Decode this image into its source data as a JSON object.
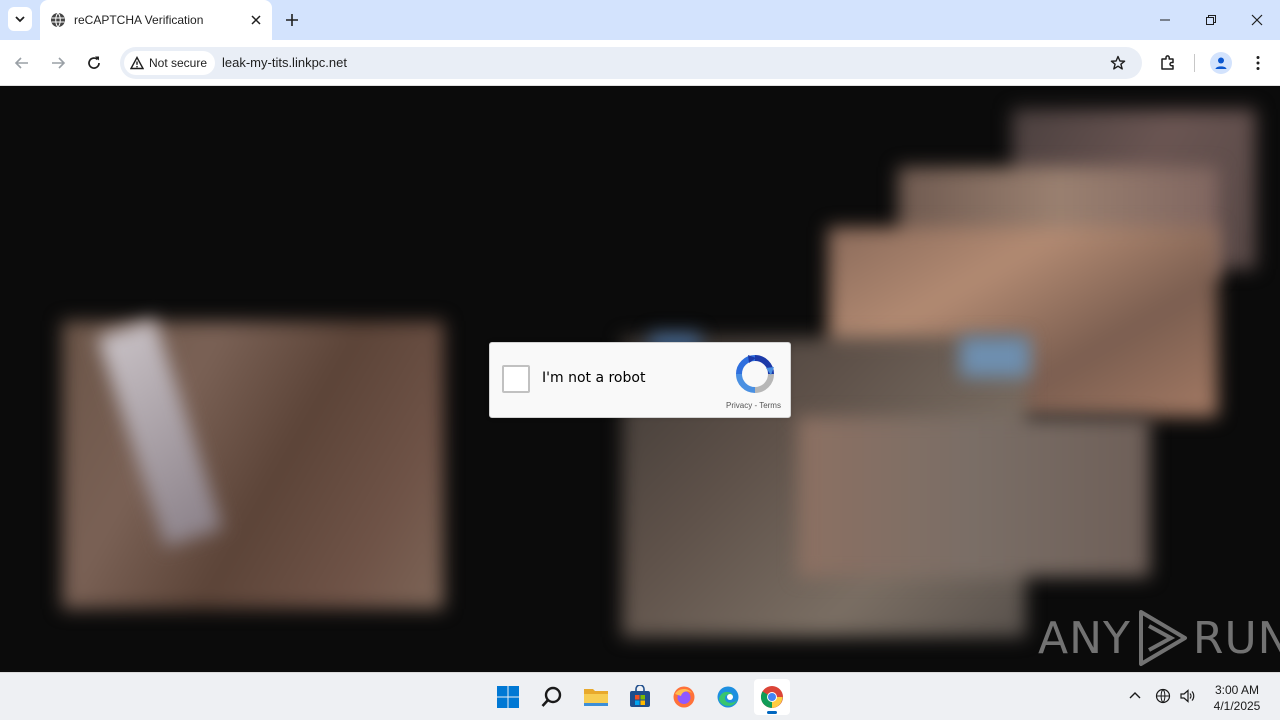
{
  "browser": {
    "tab": {
      "title": "reCAPTCHA Verification"
    },
    "address_bar": {
      "security_label": "Not secure",
      "url": "leak-my-tits.linkpc.net"
    }
  },
  "captcha": {
    "checkbox_label": "I'm not a robot",
    "links": "Privacy - Terms",
    "accent_color": "#1a73e8"
  },
  "watermark": {
    "left": "ANY",
    "right": "RUN"
  },
  "taskbar": {
    "apps": [
      "start-icon",
      "search-icon",
      "file-explorer-icon",
      "store-icon",
      "firefox-icon",
      "edge-icon",
      "chrome-icon"
    ],
    "clock": {
      "time": "3:00 AM",
      "date": "4/1/2025"
    }
  }
}
